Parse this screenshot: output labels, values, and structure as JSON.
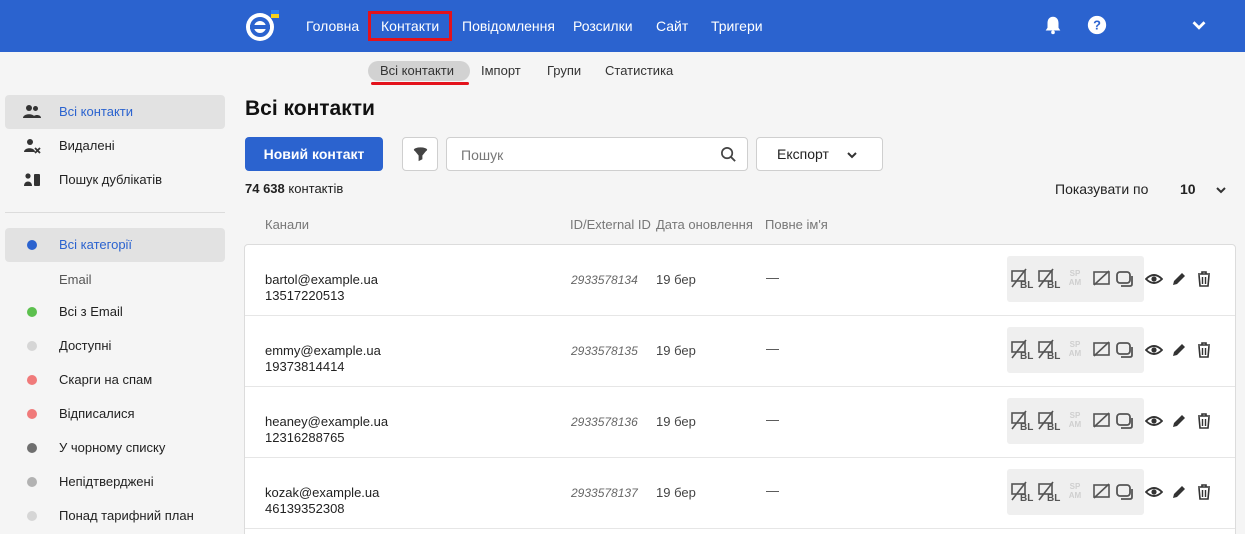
{
  "header": {
    "nav": [
      "Головна",
      "Контакти",
      "Повідомлення",
      "Розсилки",
      "Сайт",
      "Тригери"
    ]
  },
  "subnav": [
    "Всі контакти",
    "Імпорт",
    "Групи",
    "Статистика"
  ],
  "sidebar": {
    "top_items": [
      "Всі контакти",
      "Видалені",
      "Пошук дублікатів"
    ],
    "categories_label": "Всі категорії",
    "section_label": "Email",
    "email_items": [
      {
        "label": "Всі з Email",
        "color": "#5cc04e"
      },
      {
        "label": "Доступні",
        "color": "#d6d6d6"
      },
      {
        "label": "Скарги на спам",
        "color": "#f07a7a"
      },
      {
        "label": "Відписалися",
        "color": "#f07a7a"
      },
      {
        "label": "У чорному списку",
        "color": "#6f6f6f"
      },
      {
        "label": "Непідтверджені",
        "color": "#b2b2b2"
      },
      {
        "label": "Понад тарифний план",
        "color": "#d6d6d6"
      }
    ]
  },
  "main": {
    "title": "Всі контакти",
    "new_contact": "Новий контакт",
    "search_placeholder": "Пошук",
    "export": "Експорт",
    "count_value": "74 638",
    "count_label": "контактів",
    "show_label": "Показувати по",
    "show_value": "10",
    "columns": [
      "Канали",
      "ID/External ID",
      "Дата оновлення",
      "Повне ім'я"
    ],
    "rows": [
      {
        "email": "bartol@example.ua",
        "phone": "13517220513",
        "id": "2933578134",
        "date": "19 бер",
        "name": "—"
      },
      {
        "email": "emmy@example.ua",
        "phone": "19373814414",
        "id": "2933578135",
        "date": "19 бер",
        "name": "—"
      },
      {
        "email": "heaney@example.ua",
        "phone": "12316288765",
        "id": "2933578136",
        "date": "19 бер",
        "name": "—"
      },
      {
        "email": "kozak@example.ua",
        "phone": "46139352308",
        "id": "2933578137",
        "date": "19 бер",
        "name": "—"
      }
    ]
  },
  "colors": {
    "brand": "#2b63cf",
    "highlight": "#e3121b"
  }
}
